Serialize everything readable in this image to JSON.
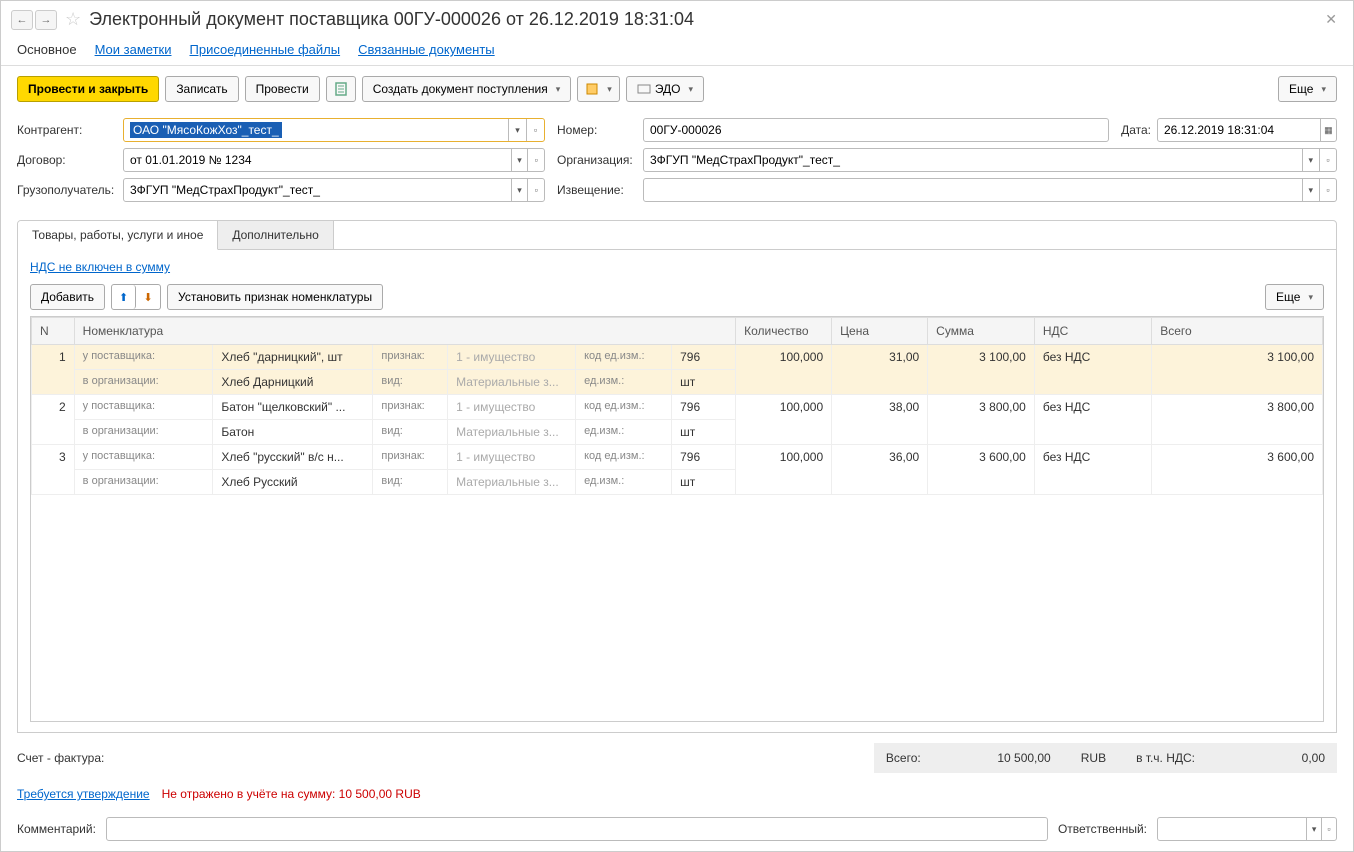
{
  "title": "Электронный документ поставщика 00ГУ-000026 от 26.12.2019 18:31:04",
  "nav_tabs": {
    "main": "Основное",
    "notes": "Мои заметки",
    "files": "Присоединенные файлы",
    "related": "Связанные документы"
  },
  "toolbar": {
    "post_close": "Провести и закрыть",
    "save": "Записать",
    "post": "Провести",
    "create_receipt": "Создать документ поступления",
    "edo": "ЭДО",
    "more": "Еще"
  },
  "fields": {
    "counterparty_lbl": "Контрагент:",
    "counterparty": "ОАО \"МясоКожХоз\"_тест_",
    "number_lbl": "Номер:",
    "number": "00ГУ-000026",
    "date_lbl": "Дата:",
    "date": "26.12.2019 18:31:04",
    "contract_lbl": "Договор:",
    "contract": "от 01.01.2019 № 1234",
    "org_lbl": "Организация:",
    "org": "3ФГУП \"МедСтрахПродукт\"_тест_",
    "consignee_lbl": "Грузополучатель:",
    "consignee": "3ФГУП \"МедСтрахПродукт\"_тест_",
    "notice_lbl": "Извещение:",
    "notice": ""
  },
  "sub_tabs": {
    "goods": "Товары, работы, услуги и иное",
    "extra": "Дополнительно"
  },
  "vat_link": "НДС не включен в сумму",
  "table_toolbar": {
    "add": "Добавить",
    "set_attr": "Установить признак номенклатуры",
    "more": "Еще"
  },
  "columns": {
    "n": "N",
    "nom": "Номенклатура",
    "qty": "Количество",
    "price": "Цена",
    "sum": "Сумма",
    "vat": "НДС",
    "total": "Всего"
  },
  "row_labels": {
    "supplier": "у поставщика:",
    "org": "в организации:",
    "attr": "признак:",
    "kind": "вид:",
    "code": "код ед.изм.:",
    "unit": "ед.изм.:"
  },
  "row_vals": {
    "attr": "1 - имущество",
    "kind": "Материальные з..."
  },
  "rows": [
    {
      "n": "1",
      "sup_name": "Хлеб \"дарницкий\", шт",
      "org_name": "Хлеб Дарницкий",
      "code": "796",
      "unit": "шт",
      "qty": "100,000",
      "price": "31,00",
      "sum": "3 100,00",
      "vat": "без НДС",
      "total": "3 100,00"
    },
    {
      "n": "2",
      "sup_name": "Батон \"щелковский\" ...",
      "org_name": "Батон",
      "code": "796",
      "unit": "шт",
      "qty": "100,000",
      "price": "38,00",
      "sum": "3 800,00",
      "vat": "без НДС",
      "total": "3 800,00"
    },
    {
      "n": "3",
      "sup_name": "Хлеб \"русский\" в/с н...",
      "org_name": "Хлеб Русский",
      "code": "796",
      "unit": "шт",
      "qty": "100,000",
      "price": "36,00",
      "sum": "3 600,00",
      "vat": "без НДС",
      "total": "3 600,00"
    }
  ],
  "footer": {
    "invoice_lbl": "Счет - фактура:",
    "total_lbl": "Всего:",
    "total": "10 500,00",
    "currency": "RUB",
    "incl_vat_lbl": "в т.ч. НДС:",
    "incl_vat": "0,00",
    "approval": "Требуется утверждение",
    "not_reflected": "Не отражено в учёте на сумму: 10 500,00 RUB",
    "comment_lbl": "Комментарий:",
    "responsible_lbl": "Ответственный:"
  }
}
